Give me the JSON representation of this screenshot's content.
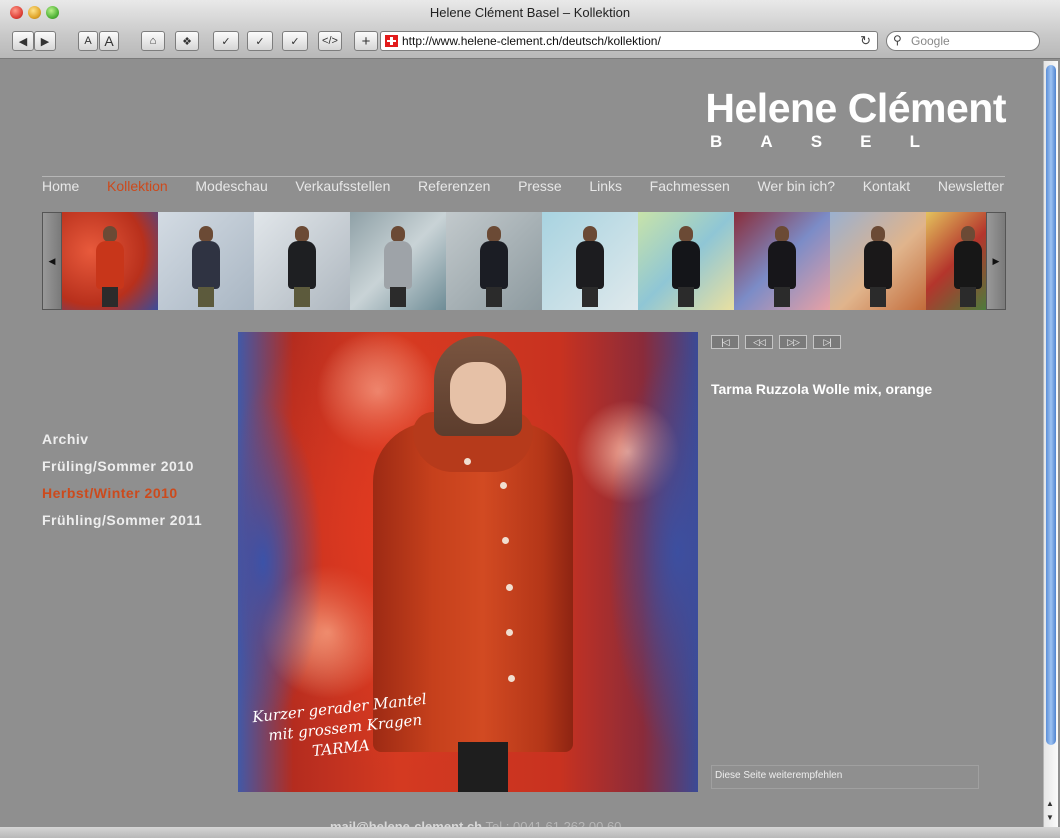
{
  "browser": {
    "title": "Helene Clément Basel – Kollektion",
    "url": "http://www.helene-clement.ch/deutsch/kollektion/",
    "search_placeholder": "Google",
    "toolbar": {
      "back": "◀",
      "forward": "▶",
      "text_smaller": "A",
      "text_larger": "A",
      "add": "+"
    }
  },
  "site": {
    "brand_name": "Helene Clément",
    "brand_city": [
      "B",
      "A",
      "S",
      "E",
      "L"
    ],
    "nav": [
      {
        "label": "Home",
        "active": false
      },
      {
        "label": "Kollektion",
        "active": true
      },
      {
        "label": "Modeschau",
        "active": false
      },
      {
        "label": "Verkaufsstellen",
        "active": false
      },
      {
        "label": "Referenzen",
        "active": false
      },
      {
        "label": "Presse",
        "active": false
      },
      {
        "label": "Links",
        "active": false
      },
      {
        "label": "Fachmessen",
        "active": false
      },
      {
        "label": "Wer bin ich?",
        "active": false
      },
      {
        "label": "Kontakt",
        "active": false
      },
      {
        "label": "Newsletter",
        "active": false
      }
    ],
    "archive": [
      {
        "label": "Archiv",
        "active": false
      },
      {
        "label": "Früling/Sommer 2010",
        "active": false
      },
      {
        "label": "Herbst/Winter 2010",
        "active": true
      },
      {
        "label": "Frühling/Sommer 2011",
        "active": false
      }
    ],
    "photo_caption": [
      "Kurzer gerader Mantel",
      "mit grossem Kragen",
      "TARMA"
    ],
    "product_title": "Tarma Ruzzola Wolle mix, orange",
    "pager": [
      "|◁",
      "◁◁",
      "▷▷",
      "▷|"
    ],
    "recommend": "Diese Seite weiterempfehlen",
    "footer": {
      "email": "mail@helene-clement.ch",
      "phone": "Tel.: 0041 61 262 00 60"
    },
    "colors": {
      "page_bg": "#8f8f8f",
      "accent": "#cc4a1c",
      "text": "#ffffff"
    }
  }
}
